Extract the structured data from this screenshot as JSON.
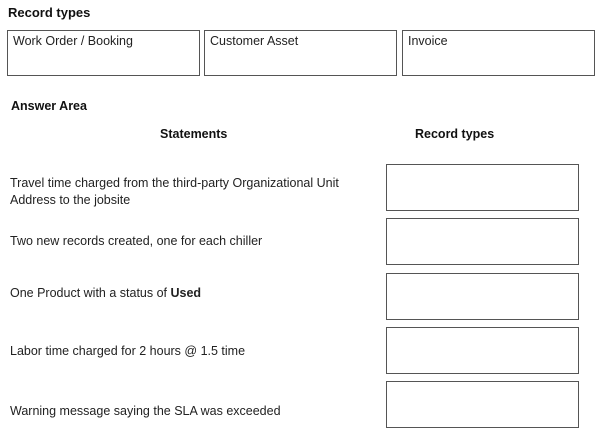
{
  "record_types": {
    "title": "Record types",
    "items": [
      "Work Order / Booking",
      "Customer Asset",
      "Invoice"
    ]
  },
  "answer_area": {
    "title": "Answer Area",
    "headers": {
      "statements": "Statements",
      "record_types": "Record types"
    },
    "statements": [
      {
        "text": "Travel time charged from the third-party Organizational Unit Address to the jobsite"
      },
      {
        "text": "Two new records created, one for each chiller"
      },
      {
        "prefix": "One Product with a status of ",
        "bold": "Used"
      },
      {
        "text": "Labor time charged for 2 hours @ 1.5 time"
      },
      {
        "text": "Warning message saying the SLA was exceeded"
      }
    ]
  }
}
